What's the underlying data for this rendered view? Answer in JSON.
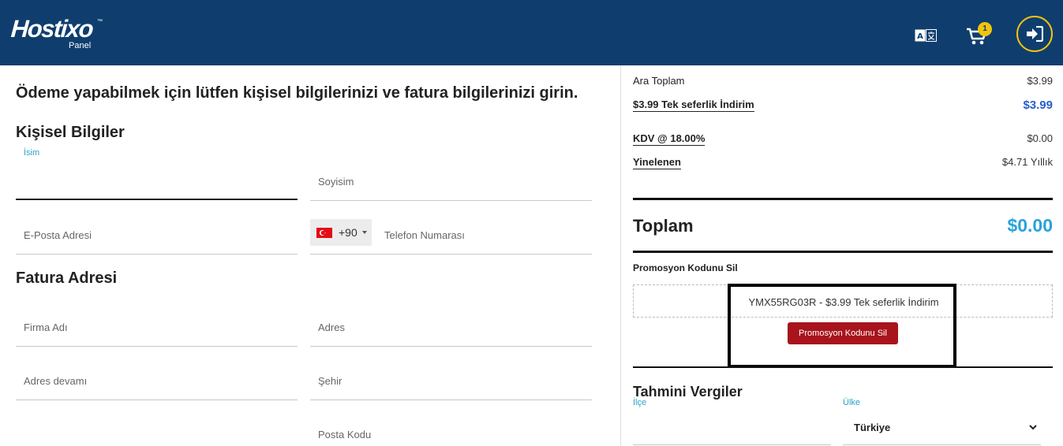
{
  "header": {
    "logo_text": "Hostixo",
    "logo_tm": "™",
    "logo_sub": "Panel",
    "cart_count": "1",
    "icons": [
      "language-icon",
      "cart-icon",
      "login-icon"
    ],
    "bg_color": "#0f3e6e",
    "accent_color": "#f1c40f"
  },
  "intro": "Ödeme yapabilmek için lütfen kişisel bilgilerinizi ve fatura bilgilerinizi girin.",
  "personal": {
    "title": "Kişisel Bilgiler",
    "first_name_label": "İsim",
    "last_name_placeholder": "Soyisim",
    "email_placeholder": "E-Posta Adresi",
    "phone_dial": "+90",
    "phone_placeholder": "Telefon Numarası"
  },
  "billing": {
    "title": "Fatura Adresi",
    "company_placeholder": "Firma Adı",
    "address_placeholder": "Adres",
    "address2_placeholder": "Adres devamı",
    "city_placeholder": "Şehir",
    "postcode_placeholder": "Posta Kodu"
  },
  "summary": {
    "subtotal_label": "Ara Toplam",
    "subtotal_value": "$3.99",
    "discount_label": "$3.99 Tek seferlik İndirim",
    "discount_value": "$3.99",
    "tax_label": "KDV @ 18.00%",
    "tax_value": "$0.00",
    "recurring_label": "Yinelenen",
    "recurring_value": "$4.71 Yıllık",
    "total_label": "Toplam",
    "total_value": "$0.00"
  },
  "promo": {
    "title": "Promosyon Kodunu Sil",
    "applied": "YMX55RG03R - $3.99 Tek seferlik İndirim",
    "remove_button": "Promosyon Kodunu Sil"
  },
  "taxes": {
    "title": "Tahmini Vergiler",
    "district_label": "İlçe",
    "country_label": "Ülke",
    "country_value": "Türkiye"
  }
}
